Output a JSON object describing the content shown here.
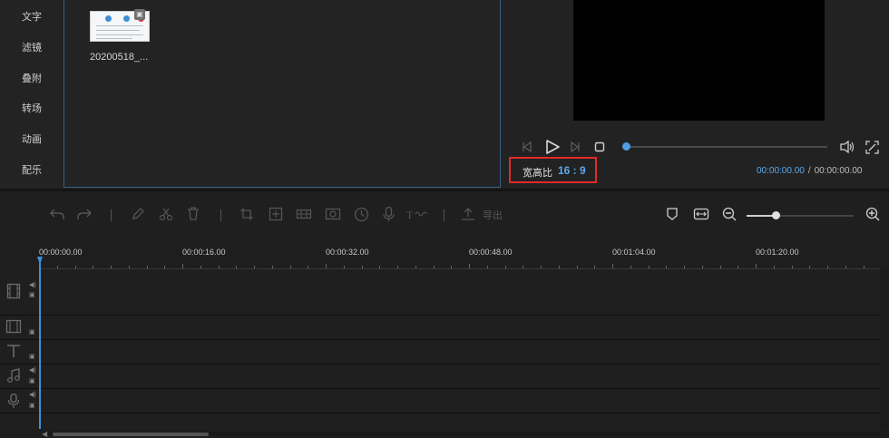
{
  "sidebar": {
    "items": [
      {
        "label": "文字"
      },
      {
        "label": "滤镜"
      },
      {
        "label": "叠附"
      },
      {
        "label": "转场"
      },
      {
        "label": "动画"
      },
      {
        "label": "配乐"
      }
    ]
  },
  "media": {
    "items": [
      {
        "name": "20200518_..."
      }
    ]
  },
  "preview": {
    "aspect_label": "宽高比",
    "aspect_value": "16 : 9",
    "current_time": "00:00:00.00",
    "time_separator": "/",
    "total_time": "00:00:00.00",
    "seek_progress": 0.0
  },
  "toolbar": {
    "export_label": "导出",
    "zoom_level": 0.27
  },
  "ruler": {
    "labels": [
      "00:00:00.00",
      "00:00:16.00",
      "00:00:32.00",
      "00:00:48.00",
      "00:01:04.00",
      "00:01:20.00"
    ]
  },
  "tracks": [
    {
      "type": "video",
      "icon": "film-icon"
    },
    {
      "type": "overlay",
      "icon": "overlay-film-icon"
    },
    {
      "type": "text",
      "icon": "text-icon"
    },
    {
      "type": "music",
      "icon": "music-note-icon"
    },
    {
      "type": "voice",
      "icon": "microphone-icon"
    }
  ],
  "colors": {
    "accent": "#5aa9ee",
    "highlight_box": "#e12a2a",
    "playhead": "#3c8fd9"
  }
}
